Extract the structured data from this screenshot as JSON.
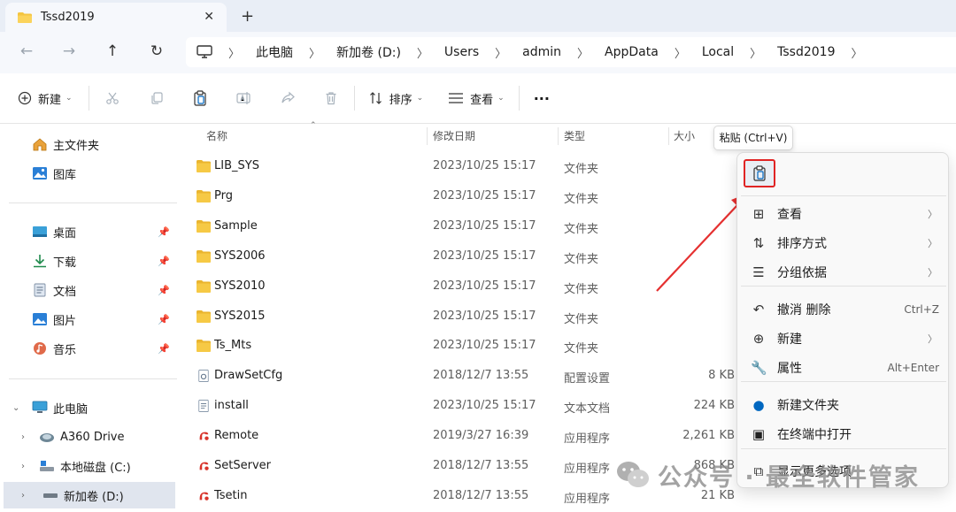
{
  "tab": {
    "title": "Tssd2019",
    "close_glyph": "✕",
    "new_tab_glyph": "+"
  },
  "nav": {
    "back_icon": "←",
    "forward_icon": "→",
    "up_icon": "↑",
    "refresh_icon": "↻",
    "breadcrumb": [
      "此电脑",
      "新加卷 (D:)",
      "Users",
      "admin",
      "AppData",
      "Local",
      "Tssd2019"
    ]
  },
  "toolbar": {
    "new_label": "新建",
    "sort_label": "排序",
    "view_label": "查看",
    "more_label": "···"
  },
  "sidebar": {
    "items": [
      {
        "label": "主文件夹",
        "icon": "home-icon"
      },
      {
        "label": "图库",
        "icon": "gallery-icon"
      },
      {
        "label": "桌面",
        "icon": "desktop-icon",
        "pinned": true
      },
      {
        "label": "下载",
        "icon": "download-icon",
        "pinned": true
      },
      {
        "label": "文档",
        "icon": "document-icon",
        "pinned": true
      },
      {
        "label": "图片",
        "icon": "pictures-icon",
        "pinned": true
      },
      {
        "label": "音乐",
        "icon": "music-icon",
        "pinned": true
      },
      {
        "label": "此电脑",
        "icon": "computer-icon"
      },
      {
        "label": "A360 Drive",
        "icon": "cloud-drive-icon"
      },
      {
        "label": "本地磁盘 (C:)",
        "icon": "drive-icon"
      },
      {
        "label": "新加卷 (D:)",
        "icon": "drive-icon",
        "selected": true
      }
    ]
  },
  "columns": {
    "name": "名称",
    "date": "修改日期",
    "type": "类型",
    "size": "大小"
  },
  "files": [
    {
      "name": "LIB_SYS",
      "date": "2023/10/25 15:17",
      "type": "文件夹",
      "size": "",
      "kind": "folder"
    },
    {
      "name": "Prg",
      "date": "2023/10/25 15:17",
      "type": "文件夹",
      "size": "",
      "kind": "folder"
    },
    {
      "name": "Sample",
      "date": "2023/10/25 15:17",
      "type": "文件夹",
      "size": "",
      "kind": "folder"
    },
    {
      "name": "SYS2006",
      "date": "2023/10/25 15:17",
      "type": "文件夹",
      "size": "",
      "kind": "folder"
    },
    {
      "name": "SYS2010",
      "date": "2023/10/25 15:17",
      "type": "文件夹",
      "size": "",
      "kind": "folder"
    },
    {
      "name": "SYS2015",
      "date": "2023/10/25 15:17",
      "type": "文件夹",
      "size": "",
      "kind": "folder"
    },
    {
      "name": "Ts_Mts",
      "date": "2023/10/25 15:17",
      "type": "文件夹",
      "size": "",
      "kind": "folder"
    },
    {
      "name": "DrawSetCfg",
      "date": "2018/12/7 13:55",
      "type": "配置设置",
      "size": "8 KB",
      "kind": "config"
    },
    {
      "name": "install",
      "date": "2023/10/25 15:17",
      "type": "文本文档",
      "size": "224 KB",
      "kind": "text"
    },
    {
      "name": "Remote",
      "date": "2019/3/27 16:39",
      "type": "应用程序",
      "size": "2,261 KB",
      "kind": "app"
    },
    {
      "name": "SetServer",
      "date": "2018/12/7 13:55",
      "type": "应用程序",
      "size": "868 KB",
      "kind": "app"
    },
    {
      "name": "Tsetin",
      "date": "2018/12/7 13:55",
      "type": "应用程序",
      "size": "21 KB",
      "kind": "app"
    }
  ],
  "tooltip": {
    "text": "粘贴 (Ctrl+V)"
  },
  "context_menu": {
    "items": [
      {
        "label": "查看",
        "icon": "grid-icon",
        "submenu": true
      },
      {
        "label": "排序方式",
        "icon": "sort-icon",
        "submenu": true
      },
      {
        "label": "分组依据",
        "icon": "group-icon",
        "submenu": true
      },
      {
        "label": "撤消 删除",
        "icon": "undo-icon",
        "shortcut": "Ctrl+Z"
      },
      {
        "label": "新建",
        "icon": "plus-circle-icon",
        "submenu": true
      },
      {
        "label": "属性",
        "icon": "wrench-icon",
        "shortcut": "Alt+Enter"
      },
      {
        "label": "新建文件夹",
        "icon": "new-folder-icon"
      },
      {
        "label": "在终端中打开",
        "icon": "terminal-icon"
      },
      {
        "label": "显示更多选项",
        "icon": "more-options-icon"
      }
    ]
  },
  "watermark": {
    "text": "公众号 · 最全软件管家"
  },
  "colors": {
    "accent": "#0067c0",
    "highlight_red": "#e02424",
    "folder": "#f4c541"
  }
}
